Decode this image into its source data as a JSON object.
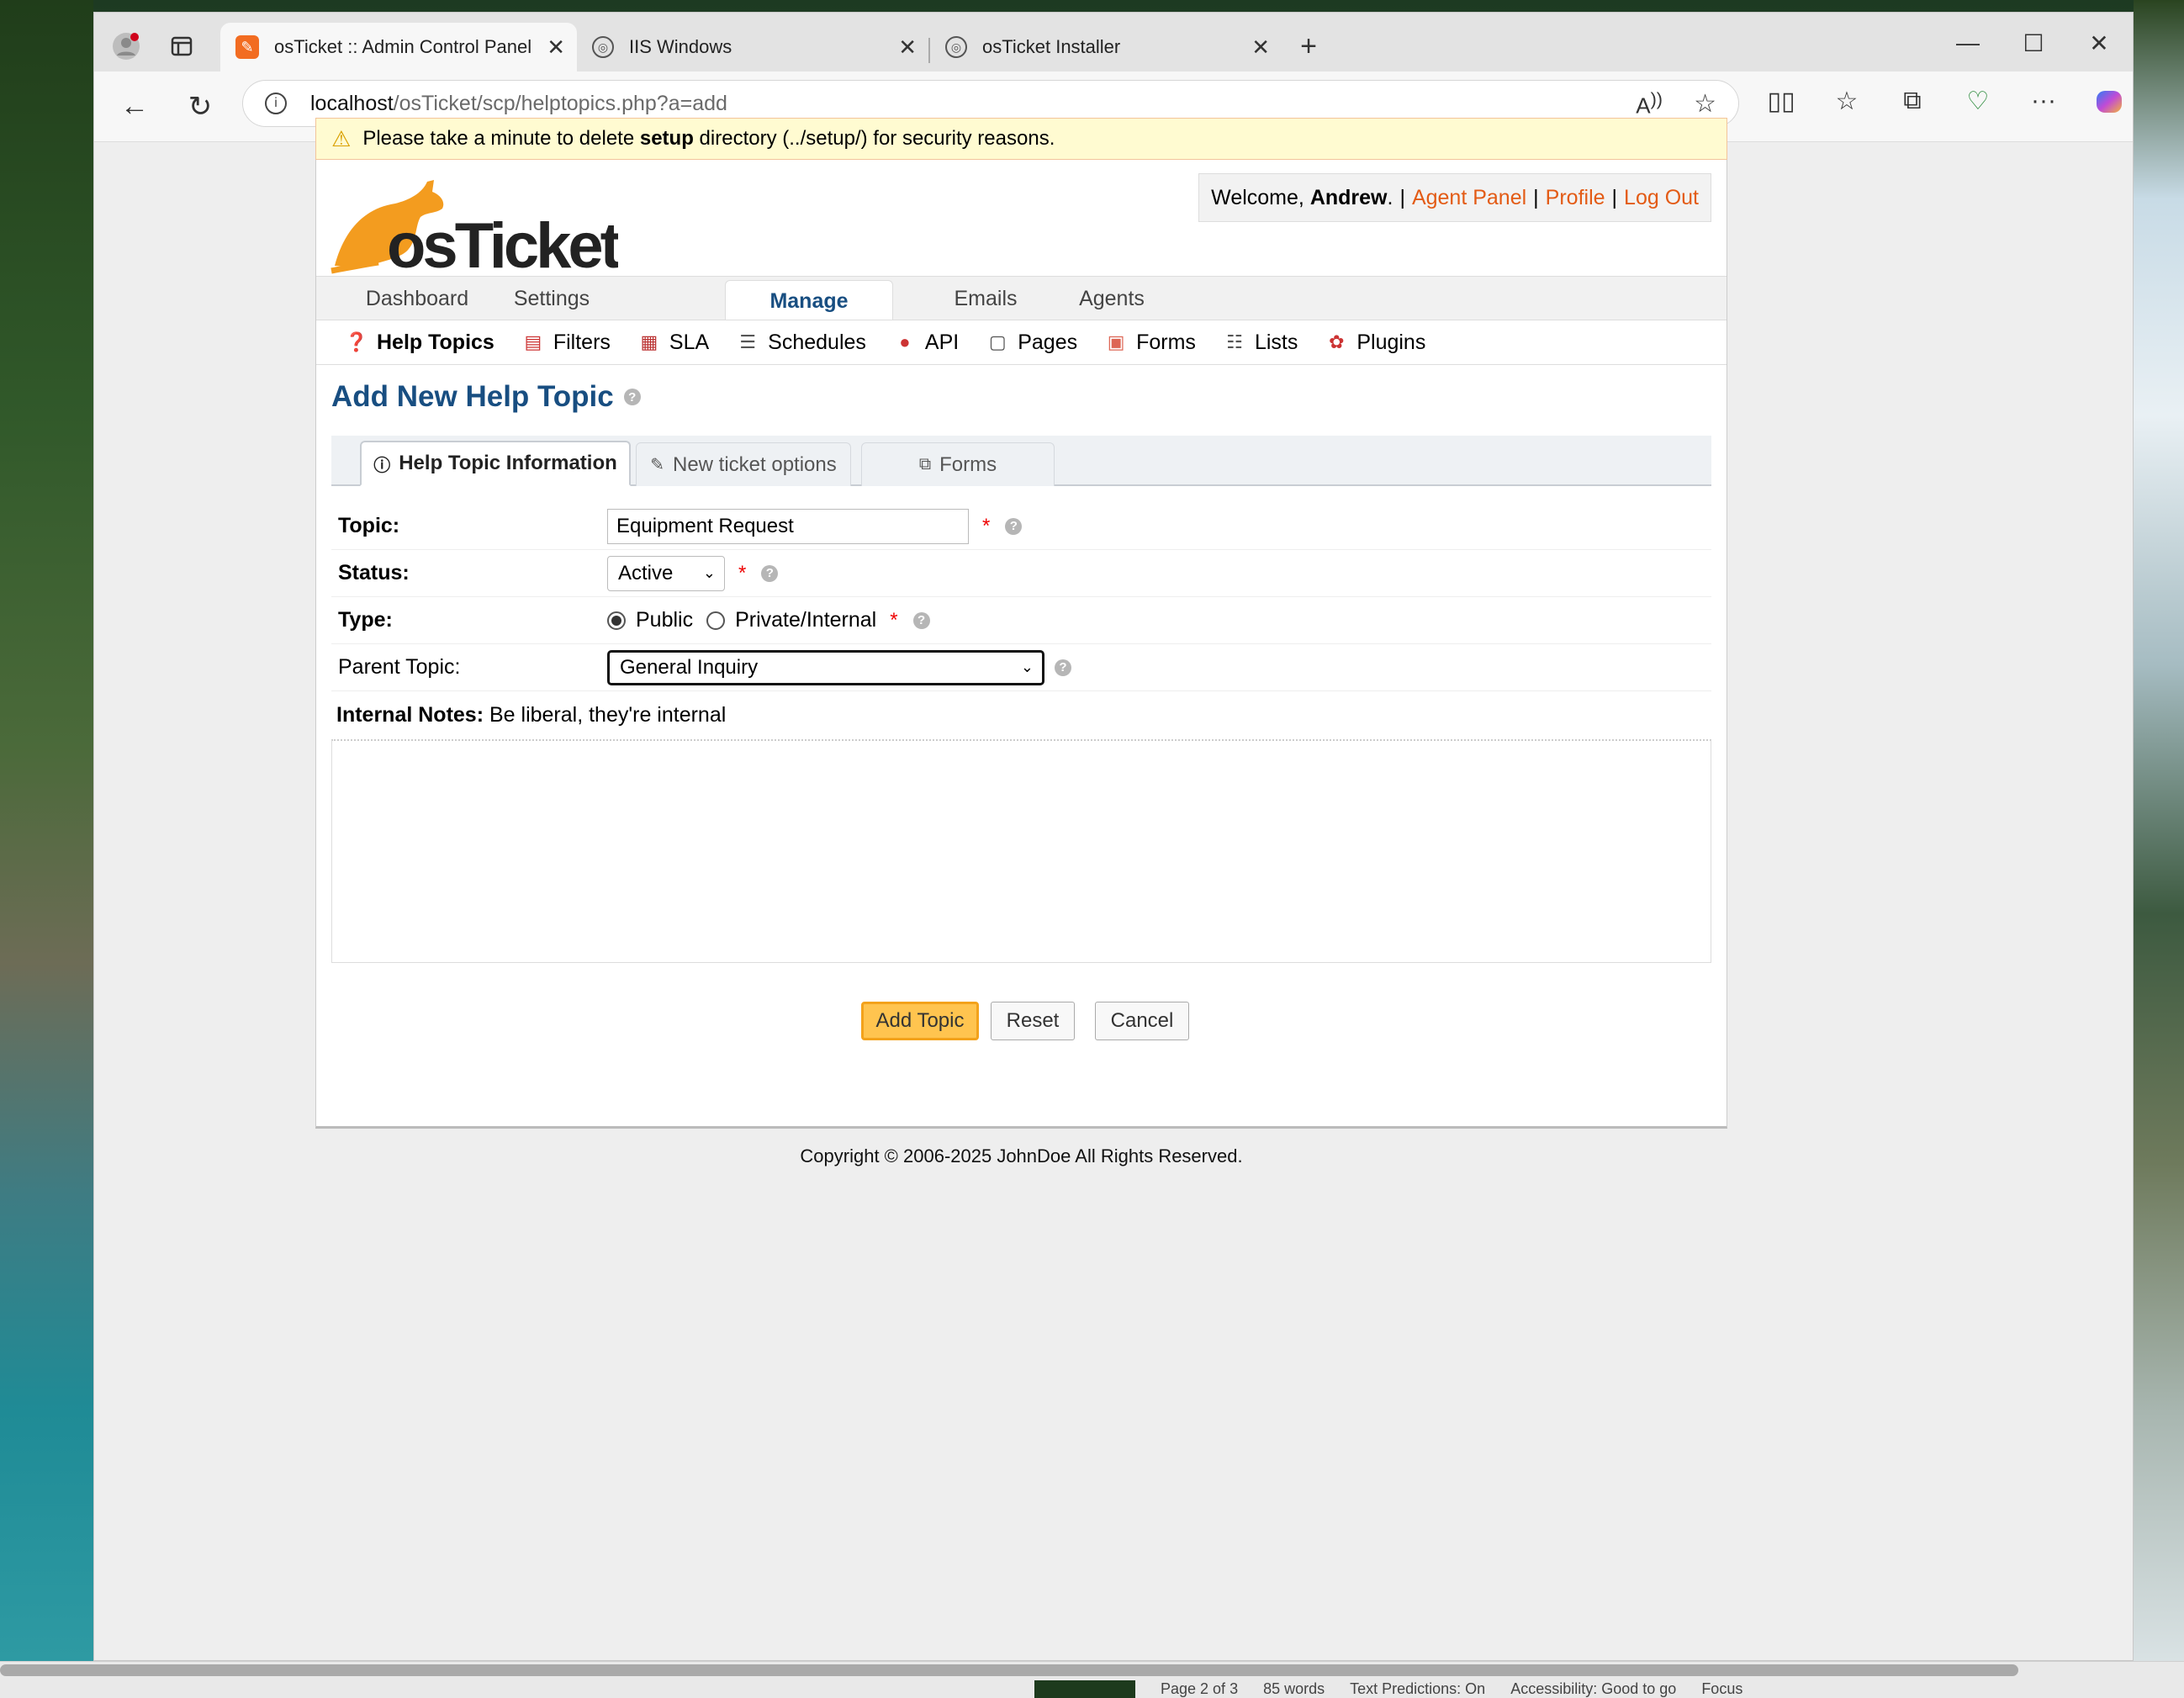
{
  "browser": {
    "tabs": [
      {
        "title": "osTicket :: Admin Control Panel",
        "active": true
      },
      {
        "title": "IIS Windows",
        "active": false
      },
      {
        "title": "osTicket Installer",
        "active": false
      }
    ],
    "url_host": "localhost",
    "url_path": "/osTicket/scp/helptopics.php?a=add"
  },
  "banner": {
    "prefix": "Please take a minute to delete",
    "bold": "setup",
    "suffix": "directory (../setup/) for security reasons."
  },
  "user": {
    "welcome": "Welcome,",
    "name": "Andrew",
    "agent_panel": "Agent Panel",
    "profile": "Profile",
    "logout": "Log Out"
  },
  "logo": {
    "text": "osTicket"
  },
  "main_nav": [
    "Dashboard",
    "Settings",
    "Manage",
    "Emails",
    "Agents"
  ],
  "sub_nav": [
    "Help Topics",
    "Filters",
    "SLA",
    "Schedules",
    "API",
    "Pages",
    "Forms",
    "Lists",
    "Plugins"
  ],
  "page": {
    "title": "Add New Help Topic",
    "form_tabs": [
      "Help Topic Information",
      "New ticket options",
      "Forms"
    ],
    "fields": {
      "topic_label": "Topic:",
      "topic_value": "Equipment Request",
      "status_label": "Status:",
      "status_value": "Active",
      "type_label": "Type:",
      "type_public": "Public",
      "type_private": "Private/Internal",
      "parent_label": "Parent Topic:",
      "parent_value": "General Inquiry",
      "notes_label": "Internal Notes:",
      "notes_hint": "Be liberal, they're internal"
    },
    "buttons": {
      "add": "Add Topic",
      "reset": "Reset",
      "cancel": "Cancel"
    },
    "footer": "Copyright © 2006-2025 JohnDoe All Rights Reserved."
  },
  "statusbar": {
    "page": "Page 2 of 3",
    "words": "85 words",
    "predictions": "Text Predictions: On",
    "accessibility": "Accessibility: Good to go",
    "focus": "Focus"
  },
  "colors": {
    "brand_orange": "#e35b15",
    "title_blue": "#184e81",
    "primary_button": "#ffc44f",
    "warning_bg": "#fffbd1"
  }
}
